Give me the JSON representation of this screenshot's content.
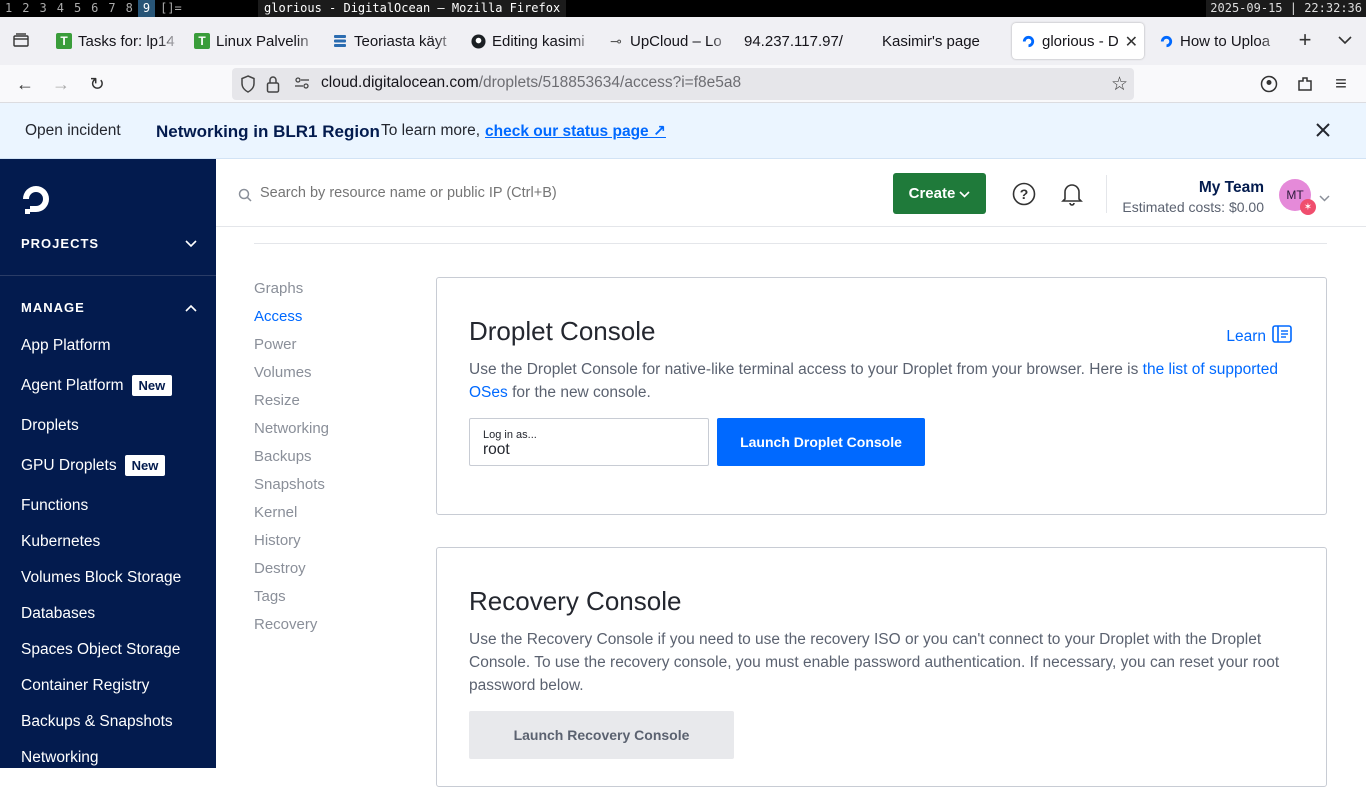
{
  "wm": {
    "workspaces": [
      "1",
      "2",
      "3",
      "4",
      "5",
      "6",
      "7",
      "8",
      "9"
    ],
    "active_workspace": "9",
    "layout": "[]=",
    "window_title": "glorious - DigitalOcean — Mozilla Firefox",
    "clock": "2025-09-15 | 22:32:36"
  },
  "browser": {
    "tabs": [
      {
        "label": "Tasks for: lp14",
        "icon": "green-t-icon"
      },
      {
        "label": "Linux Palvelin",
        "icon": "green-t-icon"
      },
      {
        "label": "Teoriasta käyt",
        "icon": "stack-icon"
      },
      {
        "label": "Editing kasimi",
        "icon": "github-icon"
      },
      {
        "label": "UpCloud – Lo",
        "icon": "upcloud-icon"
      },
      {
        "label": "94.237.117.97/",
        "icon": ""
      },
      {
        "label": "Kasimir's page",
        "icon": ""
      },
      {
        "label": "glorious - D",
        "icon": "digitalocean-icon",
        "active": true
      },
      {
        "label": "How to Uploa",
        "icon": "digitalocean-icon"
      }
    ],
    "url_domain": "cloud.digitalocean.com",
    "url_path": "/droplets/518853634/access?i=f8e5a8"
  },
  "incident": {
    "tag": "Open incident",
    "title": "Networking in BLR1 Region",
    "text": "To learn more,",
    "link": "check our status page ↗"
  },
  "sidebar": {
    "projects": "PROJECTS",
    "manage": "MANAGE",
    "items": [
      {
        "label": "App Platform"
      },
      {
        "label": "Agent Platform",
        "badge": "New"
      },
      {
        "label": "Droplets"
      },
      {
        "label": "GPU Droplets",
        "badge": "New"
      },
      {
        "label": "Functions"
      },
      {
        "label": "Kubernetes"
      },
      {
        "label": "Volumes Block Storage"
      },
      {
        "label": "Databases"
      },
      {
        "label": "Spaces Object Storage"
      },
      {
        "label": "Container Registry"
      },
      {
        "label": "Backups & Snapshots"
      },
      {
        "label": "Networking"
      }
    ]
  },
  "topbar": {
    "search_placeholder": "Search by resource name or public IP (Ctrl+B)",
    "create_label": "Create",
    "team_name": "My Team",
    "estimated_costs": "Estimated costs: $0.00",
    "avatar_initials": "MT"
  },
  "subnav": [
    "Graphs",
    "Access",
    "Power",
    "Volumes",
    "Resize",
    "Networking",
    "Backups",
    "Snapshots",
    "Kernel",
    "History",
    "Destroy",
    "Tags",
    "Recovery"
  ],
  "subnav_active": "Access",
  "droplet_console": {
    "title": "Droplet Console",
    "learn": "Learn",
    "desc_pre": "Use the Droplet Console for native-like terminal access to your Droplet from your browser. Here is ",
    "desc_link": "the list of supported OSes",
    "desc_post": " for the new console.",
    "login_label": "Log in as...",
    "login_value": "root",
    "launch_label": "Launch Droplet Console"
  },
  "recovery_console": {
    "title": "Recovery Console",
    "desc": "Use the Recovery Console if you need to use the recovery ISO or you can't connect to your Droplet with the Droplet Console. To use the recovery console, you must enable password authentication. If necessary, you can reset your root password below.",
    "launch_label": "Launch Recovery Console"
  },
  "colors": {
    "sidebar_bg": "#031b4e",
    "primary_blue": "#0069ff",
    "create_green": "#1f7a3a"
  }
}
